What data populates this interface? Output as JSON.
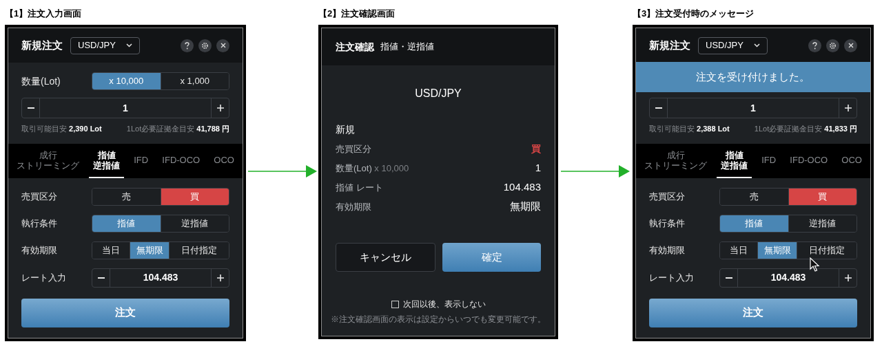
{
  "screens": [
    {
      "kind": "order_form",
      "caption": "【1】注文入力画面",
      "title": "新規注文",
      "pair": "USD/JPY",
      "lot": {
        "label": "数量(Lot)",
        "options": [
          {
            "label": "x 10,000",
            "selected": true
          },
          {
            "label": "x 1,000",
            "selected": false
          }
        ]
      },
      "quantity": "1",
      "info": [
        {
          "label": "取引可能目安",
          "value": "2,390 Lot"
        },
        {
          "label": "1Lot必要証拠金目安",
          "value": "41,788 円"
        }
      ],
      "tabs": [
        {
          "lines": [
            "成行",
            "ストリーミング"
          ],
          "selected": false
        },
        {
          "lines": [
            "指値",
            "逆指値"
          ],
          "selected": true
        },
        {
          "lines": [
            "IFD"
          ],
          "selected": false
        },
        {
          "lines": [
            "IFD-OCO"
          ],
          "selected": false
        },
        {
          "lines": [
            "OCO"
          ],
          "selected": false
        }
      ],
      "rows": [
        {
          "kind": "side",
          "label": "売買区分",
          "options": [
            {
              "label": "売",
              "selected": false
            },
            {
              "label": "買",
              "selected": true
            }
          ]
        },
        {
          "kind": "choice",
          "label": "執行条件",
          "options": [
            {
              "label": "指値",
              "selected": true
            },
            {
              "label": "逆指値",
              "selected": false
            }
          ]
        },
        {
          "kind": "choice",
          "label": "有効期限",
          "options": [
            {
              "label": "当日",
              "selected": false
            },
            {
              "label": "無期限",
              "selected": true
            },
            {
              "label": "日付指定",
              "selected": false
            }
          ]
        }
      ],
      "rate": {
        "label": "レート入力",
        "value": "104.483"
      },
      "submit": "注文"
    },
    {
      "kind": "confirm",
      "caption": "【2】注文確認画面",
      "title": "注文確認",
      "subtitle": "指値・逆指値",
      "pair": "USD/JPY",
      "section": "新規",
      "rows": [
        {
          "kind": "side",
          "label": "売買区分",
          "value": "買"
        },
        {
          "kind": "plain",
          "label": "数量(Lot)",
          "unit": "x 10,000",
          "value": "1"
        },
        {
          "kind": "plain",
          "label": "指値 レート",
          "value": "104.483"
        },
        {
          "kind": "plain",
          "label": "有効期限",
          "value": "無期限"
        }
      ],
      "cancel": "キャンセル",
      "confirm": "確定",
      "checkbox": {
        "label": "次回以後、表示しない",
        "checked": false
      },
      "note": "※注文確認画面の表示は設定からいつでも変更可能です。"
    },
    {
      "kind": "order_form",
      "caption": "【3】注文受付時のメッセージ",
      "title": "新規注文",
      "pair": "USD/JPY",
      "toast": "注文を受け付けました。",
      "cursor": true,
      "quantity": "1",
      "info": [
        {
          "label": "取引可能目安",
          "value": "2,388 Lot"
        },
        {
          "label": "1Lot必要証拠金目安",
          "value": "41,833 円"
        }
      ],
      "tabs": [
        {
          "lines": [
            "成行",
            "ストリーミング"
          ],
          "selected": false
        },
        {
          "lines": [
            "指値",
            "逆指値"
          ],
          "selected": true
        },
        {
          "lines": [
            "IFD"
          ],
          "selected": false
        },
        {
          "lines": [
            "IFD-OCO"
          ],
          "selected": false
        },
        {
          "lines": [
            "OCO"
          ],
          "selected": false
        }
      ],
      "rows": [
        {
          "kind": "side",
          "label": "売買区分",
          "options": [
            {
              "label": "売",
              "selected": false
            },
            {
              "label": "買",
              "selected": true
            }
          ]
        },
        {
          "kind": "choice",
          "label": "執行条件",
          "options": [
            {
              "label": "指値",
              "selected": true
            },
            {
              "label": "逆指値",
              "selected": false
            }
          ]
        },
        {
          "kind": "choice",
          "label": "有効期限",
          "options": [
            {
              "label": "当日",
              "selected": false
            },
            {
              "label": "無期限",
              "selected": true
            },
            {
              "label": "日付指定",
              "selected": false
            }
          ]
        }
      ],
      "rate": {
        "label": "レート入力",
        "value": "104.483"
      },
      "submit": "注文"
    }
  ]
}
